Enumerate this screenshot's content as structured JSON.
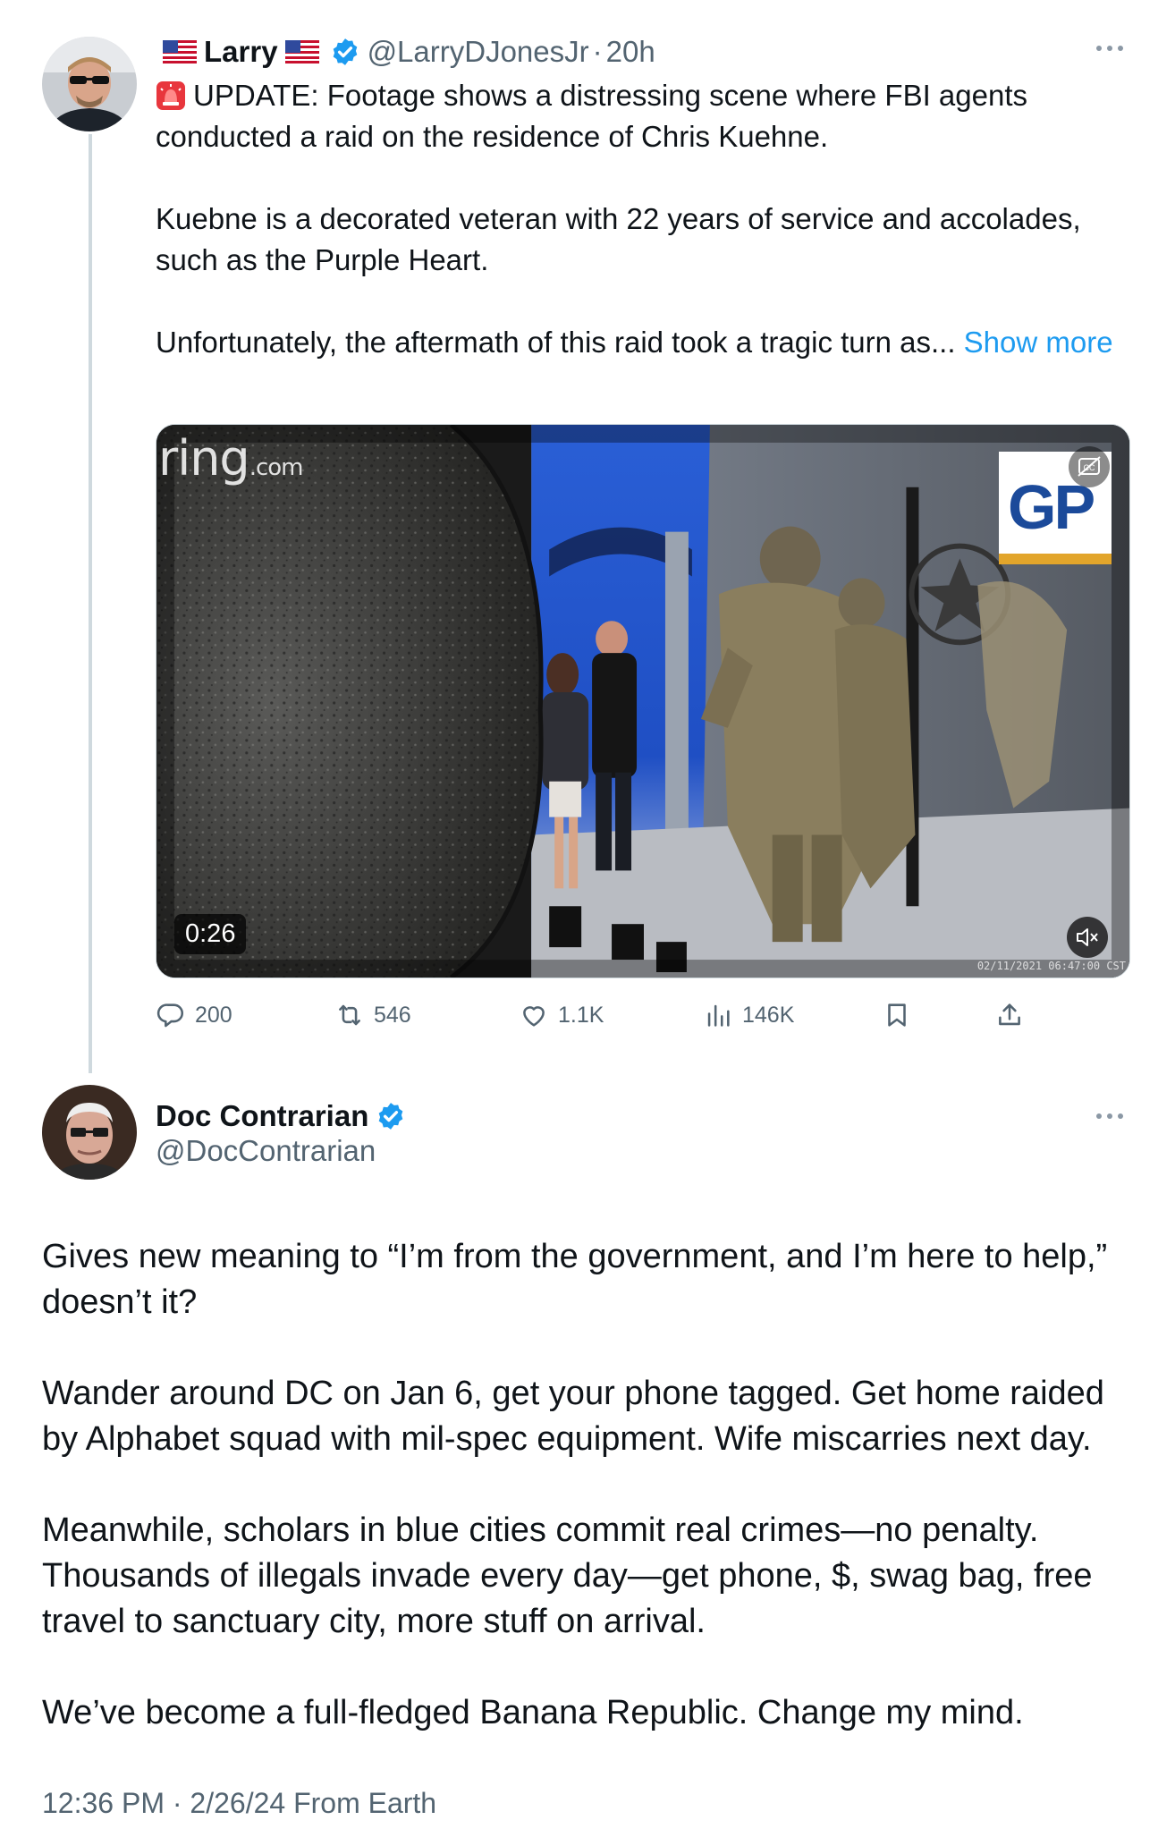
{
  "parent_tweet": {
    "author_name": "Larry",
    "handle": "@LarryDJonesJr",
    "separator": "·",
    "time": "20h",
    "text_line_1": "UPDATE: Footage shows a distressing scene where FBI agents conducted a raid on the residence of Chris Kuehne.",
    "text_line_2": "Kuebne is a decorated veteran with 22 years of service and accolades, such as the Purple Heart.",
    "text_line_3": "Unfortunately, the aftermath of this raid took a tragic turn as...",
    "show_more_label": "Show more",
    "media": {
      "watermark": "ring",
      "watermark_suffix": ".com",
      "logo_text": "GP",
      "duration": "0:26",
      "camera_timestamp": "02/11/2021 06:47:00 CST"
    },
    "stats": {
      "replies": "200",
      "reposts": "546",
      "likes": "1.1K",
      "views": "146K"
    }
  },
  "main_tweet": {
    "author_name": "Doc Contrarian",
    "handle": "@DocContrarian",
    "paragraph_1": "Gives new meaning to “I’m from the government, and I’m here to help,” doesn’t it?",
    "paragraph_2": "Wander around DC on Jan 6, get your phone tagged. Get home raided by Alphabet squad with mil-spec equipment. Wife miscarries next day.",
    "paragraph_3": "Meanwhile, scholars in blue cities commit real crimes—no penalty. Thousands of illegals invade every day—get phone, $, swag bag, free travel to sanctuary city, more stuff on arrival.",
    "paragraph_4": "We’ve become a full-fledged Banana Republic. Change my mind.",
    "meta": "12:36 PM · 2/26/24 From Earth"
  },
  "icons": {
    "reply": "reply-icon",
    "repost": "repost-icon",
    "like": "heart-icon",
    "views": "views-icon",
    "bookmark": "bookmark-icon",
    "share": "share-icon",
    "verified": "verified-badge-icon",
    "flag": "us-flag-icon",
    "siren": "siren-emoji-icon",
    "more": "more-dots-icon",
    "mute": "muted-speaker-icon",
    "captions": "captions-off-icon"
  },
  "colors": {
    "text": "#0f1419",
    "secondary": "#536471",
    "link": "#1d9bf0",
    "verified": "#1d9bf0",
    "border": "#cfd9de"
  }
}
